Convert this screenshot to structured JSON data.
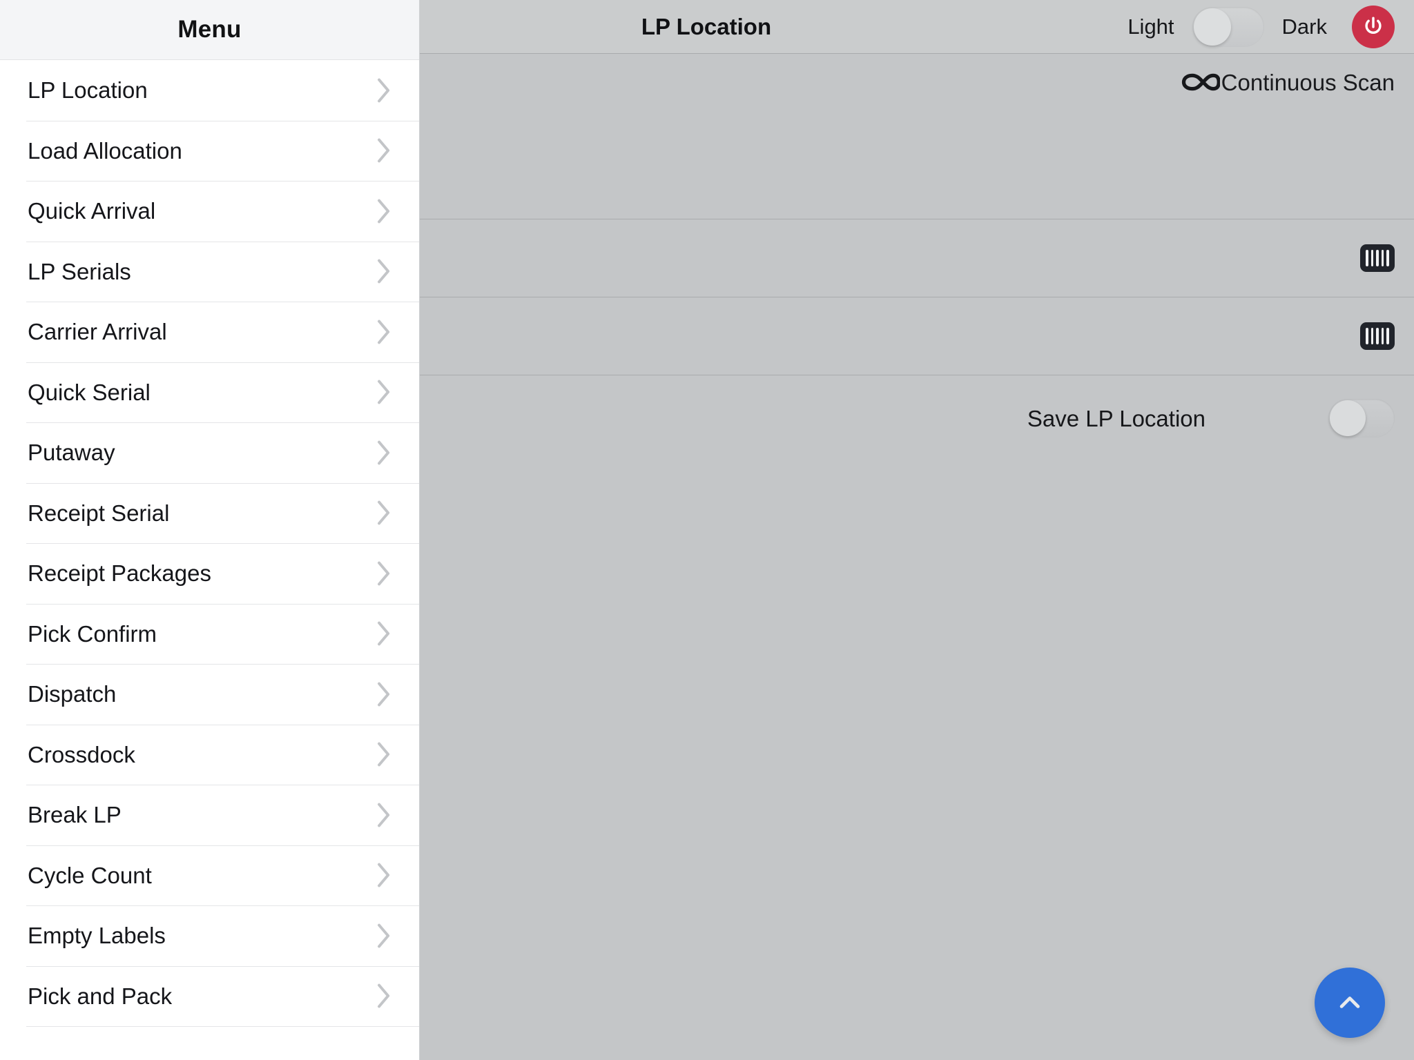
{
  "sidebar": {
    "header_title": "Menu",
    "chevron_icon": "chevron-right-icon",
    "items": [
      {
        "label": "LP Location"
      },
      {
        "label": "Load Allocation"
      },
      {
        "label": "Quick Arrival"
      },
      {
        "label": "LP Serials"
      },
      {
        "label": "Carrier Arrival"
      },
      {
        "label": "Quick Serial"
      },
      {
        "label": "Putaway"
      },
      {
        "label": "Receipt Serial"
      },
      {
        "label": "Receipt Packages"
      },
      {
        "label": "Pick Confirm"
      },
      {
        "label": "Dispatch"
      },
      {
        "label": "Crossdock"
      },
      {
        "label": "Break LP"
      },
      {
        "label": "Cycle Count"
      },
      {
        "label": "Empty Labels"
      },
      {
        "label": "Pick and Pack"
      }
    ]
  },
  "topbar": {
    "title": "LP Location",
    "light_label": "Light",
    "dark_label": "Dark",
    "theme_toggle_state": "light",
    "theme_toggle_icon": "theme-toggle",
    "power_icon": "power-icon",
    "power_color": "#cb3048"
  },
  "main": {
    "continuous_scan": {
      "label": "Continuous Scan",
      "icon": "infinity-icon"
    },
    "fields": [
      {
        "name": "lp-field",
        "value": "",
        "placeholder": "",
        "scan_icon": "barcode-icon"
      },
      {
        "name": "location-field",
        "value": "",
        "placeholder": "",
        "scan_icon": "barcode-icon"
      }
    ],
    "save_lp_location": {
      "label": "Save LP Location",
      "toggle_state": "off",
      "toggle_icon": "toggle-switch"
    },
    "fab": {
      "icon": "chevron-up-icon",
      "color": "#3070d8"
    }
  }
}
